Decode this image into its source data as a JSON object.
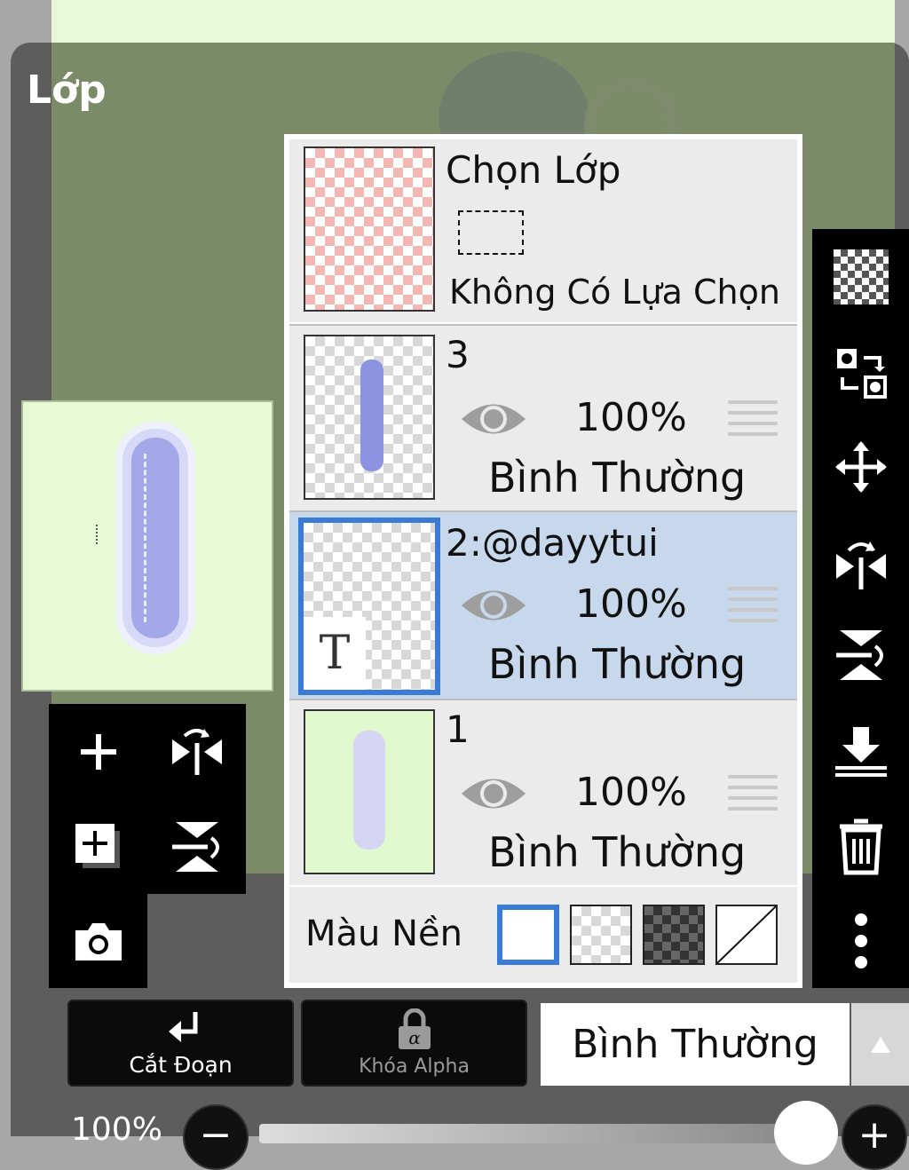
{
  "panel": {
    "title": "Lớp"
  },
  "selection_layer": {
    "title": "Chọn Lớp",
    "status": "Không Có Lựa Chọn"
  },
  "layers": [
    {
      "name": "3",
      "opacity": "100%",
      "blend": "Bình Thường",
      "selected": false
    },
    {
      "name": "2:@dayytui",
      "opacity": "100%",
      "blend": "Bình Thường",
      "selected": true,
      "type_badge": "T"
    },
    {
      "name": "1",
      "opacity": "100%",
      "blend": "Bình Thường",
      "selected": false
    }
  ],
  "background": {
    "label": "Màu Nền",
    "options": [
      "white",
      "checker-light",
      "checker-dark",
      "none"
    ],
    "selected": "white"
  },
  "bottom": {
    "clip_label": "Cắt Đoạn",
    "alpha_lock_label": "Khóa Alpha",
    "blend_mode": "Bình Thường",
    "opacity_value": "100%",
    "minus": "−",
    "plus": "+"
  },
  "left_tools": [
    "add-layer-icon",
    "flip-horizontal-icon",
    "duplicate-layer-icon",
    "flip-vertical-icon",
    "camera-icon"
  ],
  "right_tools": [
    "transparency-icon",
    "swap-icon",
    "move-icon",
    "flip-horizontal-icon",
    "flip-vertical-icon",
    "merge-down-icon",
    "trash-icon",
    "more-icon"
  ],
  "colors": {
    "accent": "#3a7bd5",
    "selected_row": "#c7d8ec"
  }
}
